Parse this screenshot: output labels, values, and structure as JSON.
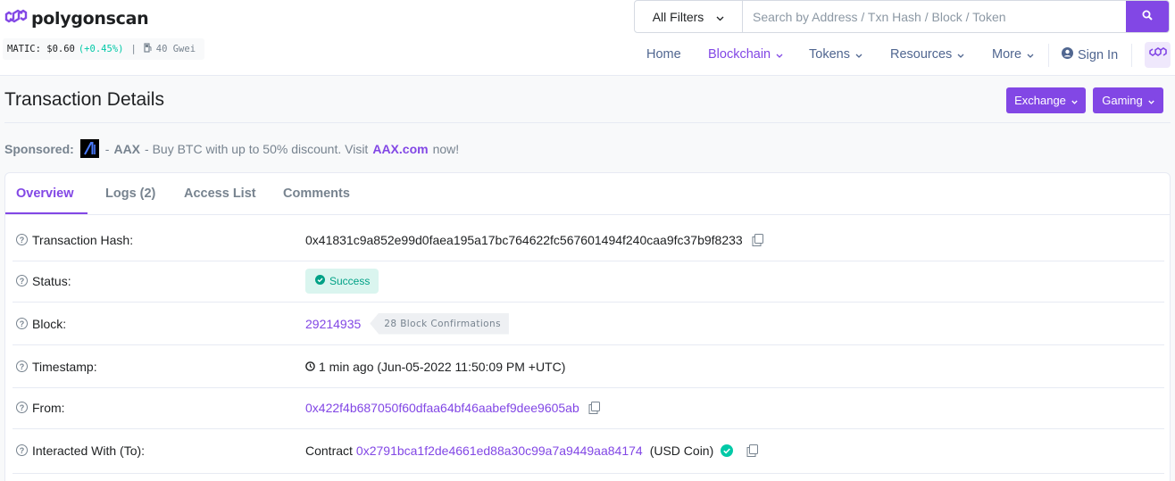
{
  "header": {
    "logo_text": "polygonscan",
    "price_label": "MATIC: $0.60",
    "price_change": "(+0.45%)",
    "separator": "|",
    "gas": "40 Gwei",
    "filter_label": "All Filters",
    "search_placeholder": "Search by Address / Txn Hash / Block / Token"
  },
  "nav": {
    "items": [
      {
        "label": "Home"
      },
      {
        "label": "Blockchain"
      },
      {
        "label": "Tokens"
      },
      {
        "label": "Resources"
      },
      {
        "label": "More"
      },
      {
        "label": "Sign In"
      }
    ]
  },
  "page": {
    "title": "Transaction Details",
    "exchange_label": "Exchange",
    "gaming_label": "Gaming"
  },
  "sponsored": {
    "label": "Sponsored:",
    "dash": "-",
    "name": "AAX",
    "text": "- Buy BTC with up to 50% discount. Visit",
    "link": "AAX.com",
    "suffix": "now!"
  },
  "tabs": [
    {
      "label": "Overview"
    },
    {
      "label": "Logs (2)"
    },
    {
      "label": "Access List"
    },
    {
      "label": "Comments"
    }
  ],
  "details": {
    "hash_label": "Transaction Hash:",
    "hash_value": "0x41831c9a852e99d0faea195a17bc764622fc567601494f240caa9fc37b9f8233",
    "status_label": "Status:",
    "status_value": "Success",
    "block_label": "Block:",
    "block_value": "29214935",
    "block_confirmations": "28 Block Confirmations",
    "timestamp_label": "Timestamp:",
    "timestamp_value": "1 min ago (Jun-05-2022 11:50:09 PM +UTC)",
    "from_label": "From:",
    "from_value": "0x422f4b687050f60dfaa64bf46aabef9dee9605ab",
    "to_label": "Interacted With (To):",
    "to_prefix": "Contract",
    "to_value": "0x2791bca1f2de4661ed88a30c99a7a9449aa84174",
    "to_name": "(USD Coin)"
  },
  "colors": {
    "accent": "#8247e5",
    "success": "#00c9a7"
  }
}
